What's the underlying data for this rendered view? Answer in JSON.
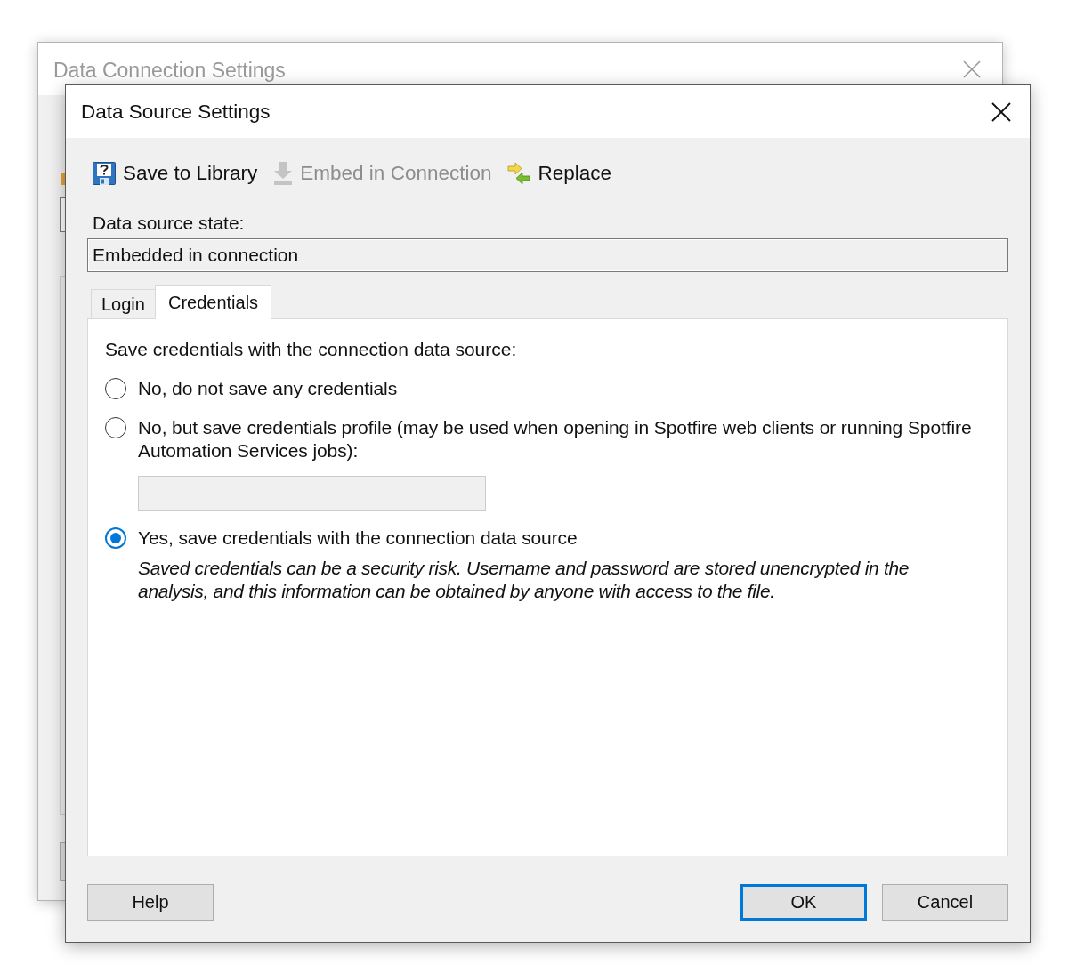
{
  "back_window": {
    "title": "Data Connection Settings"
  },
  "window": {
    "title": "Data Source Settings"
  },
  "toolbar": [
    {
      "label": "Save to Library",
      "kind": "library",
      "disabled": false
    },
    {
      "label": "Embed in Connection",
      "kind": "embed",
      "disabled": true
    },
    {
      "label": "Replace",
      "kind": "replace",
      "disabled": false
    }
  ],
  "state_field": {
    "label": "Data source state:",
    "value": "Embedded in connection",
    "read_only": true
  },
  "tabs": [
    {
      "label": "Login",
      "selected": false
    },
    {
      "label": "Credentials",
      "selected": true
    }
  ],
  "credentials": {
    "heading": "Save credentials with the connection data source:",
    "options": [
      {
        "label": "No, do not save any credentials",
        "selected": false
      },
      {
        "label": "No, but save credentials profile (may be used when opening in Spotfire web clients or running Spotfire Automation Services jobs):",
        "selected": false,
        "profile_field": {
          "disabled": true
        }
      },
      {
        "label": "Yes, save credentials with the connection data source",
        "selected": true,
        "note": "Saved credentials can be a security risk. Username and password are stored unencrypted in the analysis, and this information can be obtained by anyone with access to the file."
      }
    ]
  },
  "help_button": {
    "label": "Help",
    "default": false
  },
  "buttons": [
    {
      "label": "OK",
      "default": true
    },
    {
      "label": "Cancel",
      "default": false
    }
  ]
}
